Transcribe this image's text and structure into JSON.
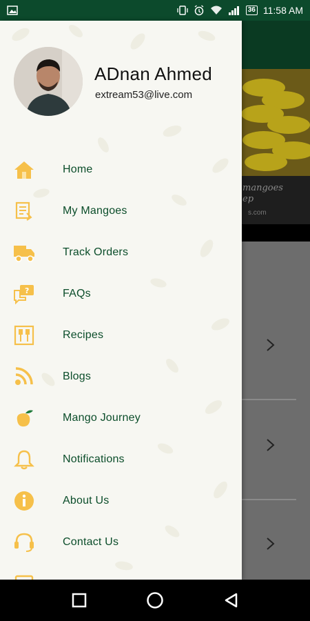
{
  "status_bar": {
    "battery": "36",
    "time": "11:58 AM"
  },
  "user": {
    "name": "ADnan Ahmed",
    "email": "extream53@live.com"
  },
  "menu": [
    {
      "label": "Home",
      "icon": "home-icon"
    },
    {
      "label": "My Mangoes",
      "icon": "my-mangoes-icon"
    },
    {
      "label": "Track Orders",
      "icon": "delivery-truck-icon"
    },
    {
      "label": "FAQs",
      "icon": "faq-icon"
    },
    {
      "label": "Recipes",
      "icon": "recipes-icon"
    },
    {
      "label": "Blogs",
      "icon": "rss-icon"
    },
    {
      "label": "Mango Journey",
      "icon": "mango-icon"
    },
    {
      "label": "Notifications",
      "icon": "bell-icon"
    },
    {
      "label": "About Us",
      "icon": "info-icon"
    },
    {
      "label": "Contact Us",
      "icon": "headset-icon"
    }
  ],
  "background": {
    "banner_text": "mangoes",
    "banner_subtext": "ep",
    "banner_url_fragment": "s.com"
  },
  "colors": {
    "brand_dark_green": "#0c4a2c",
    "menu_text_green": "#0b4d2a",
    "icon_yellow": "#f6c04a"
  }
}
